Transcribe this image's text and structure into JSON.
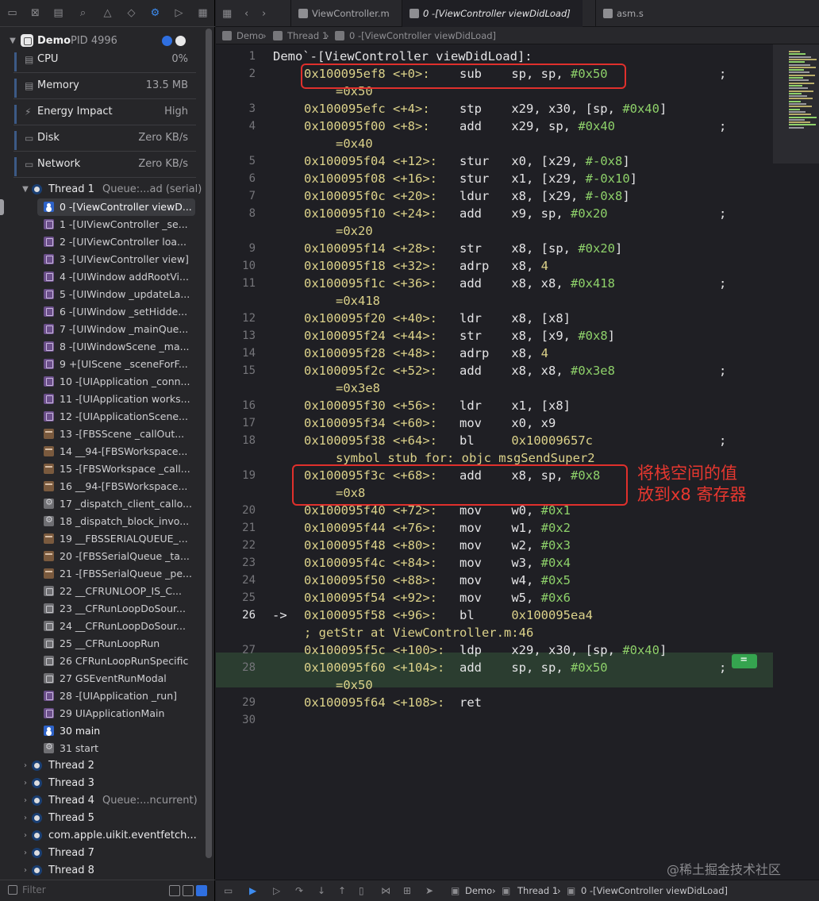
{
  "navigator": {
    "process": {
      "name": "Demo",
      "pid": "PID 4996"
    },
    "gauges": [
      {
        "label": "CPU",
        "value": "0%",
        "icon": "cpu-icon"
      },
      {
        "label": "Memory",
        "value": "13.5 MB",
        "icon": "memory-icon"
      },
      {
        "label": "Energy Impact",
        "value": "High",
        "icon": "energy-icon"
      },
      {
        "label": "Disk",
        "value": "Zero KB/s",
        "icon": "disk-icon"
      },
      {
        "label": "Network",
        "value": "Zero KB/s",
        "icon": "network-icon"
      }
    ],
    "thread1": {
      "name": "Thread 1",
      "queue": "Queue:...ad (serial)"
    },
    "frames": [
      {
        "label": "0 -[ViewController viewD...",
        "kind": "user"
      },
      {
        "label": "1 -[UIViewController _se...",
        "kind": "purple"
      },
      {
        "label": "2 -[UIViewController loa...",
        "kind": "purple"
      },
      {
        "label": "3 -[UIViewController view]",
        "kind": "purple"
      },
      {
        "label": "4 -[UIWindow addRootVi...",
        "kind": "purple"
      },
      {
        "label": "5 -[UIWindow _updateLa...",
        "kind": "purple"
      },
      {
        "label": "6 -[UIWindow _setHidde...",
        "kind": "purple"
      },
      {
        "label": "7 -[UIWindow _mainQue...",
        "kind": "purple"
      },
      {
        "label": "8 -[UIWindowScene _ma...",
        "kind": "purple"
      },
      {
        "label": "9 +[UIScene _sceneForF...",
        "kind": "purple"
      },
      {
        "label": "10 -[UIApplication _conn...",
        "kind": "purple"
      },
      {
        "label": "11 -[UIApplication works...",
        "kind": "purple"
      },
      {
        "label": "12 -[UIApplicationScene...",
        "kind": "purple"
      },
      {
        "label": "13 -[FBSScene _callOut...",
        "kind": "brown"
      },
      {
        "label": "14 __94-[FBSWorkspace...",
        "kind": "brown"
      },
      {
        "label": "15 -[FBSWorkspace _call...",
        "kind": "brown"
      },
      {
        "label": "16 __94-[FBSWorkspace...",
        "kind": "brown"
      },
      {
        "label": "17 _dispatch_client_callo...",
        "kind": "gear"
      },
      {
        "label": "18 _dispatch_block_invo...",
        "kind": "gear"
      },
      {
        "label": "19 __FBSSERIALQUEUE_...",
        "kind": "brown"
      },
      {
        "label": "20 -[FBSSerialQueue _ta...",
        "kind": "brown"
      },
      {
        "label": "21 -[FBSSerialQueue _pe...",
        "kind": "brown"
      },
      {
        "label": "22 __CFRUNLOOP_IS_C...",
        "kind": "gray"
      },
      {
        "label": "23 __CFRunLoopDoSour...",
        "kind": "gray"
      },
      {
        "label": "24 __CFRunLoopDoSour...",
        "kind": "gray"
      },
      {
        "label": "25 __CFRunLoopRun",
        "kind": "gray"
      },
      {
        "label": "26 CFRunLoopRunSpecific",
        "kind": "gray"
      },
      {
        "label": "27 GSEventRunModal",
        "kind": "gray"
      },
      {
        "label": "28 -[UIApplication _run]",
        "kind": "purple"
      },
      {
        "label": "29 UIApplicationMain",
        "kind": "purple"
      },
      {
        "label": "30 main",
        "kind": "user"
      },
      {
        "label": "31 start",
        "kind": "gear"
      }
    ],
    "other_threads": [
      {
        "name": "Thread 2",
        "queue": ""
      },
      {
        "name": "Thread 3",
        "queue": ""
      },
      {
        "name": "Thread 4",
        "queue": "Queue:...ncurrent)"
      },
      {
        "name": "Thread 5",
        "queue": ""
      },
      {
        "name": "com.apple.uikit.eventfetch...",
        "queue": ""
      },
      {
        "name": "Thread 7",
        "queue": ""
      },
      {
        "name": "Thread 8",
        "queue": ""
      }
    ],
    "filter_placeholder": "Filter"
  },
  "tabs": [
    {
      "label": "ViewController.m",
      "active": false
    },
    {
      "label": "0 -[ViewController viewDidLoad]",
      "active": true
    },
    {
      "label": "asm.s",
      "active": false
    }
  ],
  "jumpbar": {
    "app": "Demo",
    "thread": "Thread 1",
    "frame": "0 -[ViewController viewDidLoad]"
  },
  "code": {
    "header": "Demo`-[ViewController viewDidLoad]:",
    "current_line": 26,
    "lines": [
      {
        "n": "1"
      },
      {
        "n": "2",
        "addr": "0x100095ef8",
        "off": "<+0>:",
        "op": "sub",
        "args": "sp, sp, ",
        "imm": "#0x50",
        "semi": true,
        "cont": "=0x50"
      },
      {
        "n": "3",
        "addr": "0x100095efc",
        "off": "<+4>:",
        "op": "stp",
        "args": "x29, x30, [sp, ",
        "imm": "#0x40",
        "tail": "]"
      },
      {
        "n": "4",
        "addr": "0x100095f00",
        "off": "<+8>:",
        "op": "add",
        "args": "x29, sp, ",
        "imm": "#0x40",
        "semi": true,
        "cont": "=0x40"
      },
      {
        "n": "5",
        "addr": "0x100095f04",
        "off": "<+12>:",
        "op": "stur",
        "args": "x0, [x29, ",
        "imm": "#-0x8",
        "tail": "]"
      },
      {
        "n": "6",
        "addr": "0x100095f08",
        "off": "<+16>:",
        "op": "stur",
        "args": "x1, [x29, ",
        "imm": "#-0x10",
        "tail": "]"
      },
      {
        "n": "7",
        "addr": "0x100095f0c",
        "off": "<+20>:",
        "op": "ldur",
        "args": "x8, [x29, ",
        "imm": "#-0x8",
        "tail": "]"
      },
      {
        "n": "8",
        "addr": "0x100095f10",
        "off": "<+24>:",
        "op": "add",
        "args": "x9, sp, ",
        "imm": "#0x20",
        "semi": true,
        "cont": "=0x20"
      },
      {
        "n": "9",
        "addr": "0x100095f14",
        "off": "<+28>:",
        "op": "str",
        "args": "x8, [sp, ",
        "imm": "#0x20",
        "tail": "]"
      },
      {
        "n": "10",
        "addr": "0x100095f18",
        "off": "<+32>:",
        "op": "adrp",
        "args": "x8, ",
        "num": "4"
      },
      {
        "n": "11",
        "addr": "0x100095f1c",
        "off": "<+36>:",
        "op": "add",
        "args": "x8, x8, ",
        "imm": "#0x418",
        "semi": true,
        "cont": "=0x418"
      },
      {
        "n": "12",
        "addr": "0x100095f20",
        "off": "<+40>:",
        "op": "ldr",
        "args": "x8, [x8]"
      },
      {
        "n": "13",
        "addr": "0x100095f24",
        "off": "<+44>:",
        "op": "str",
        "args": "x8, [x9, ",
        "imm": "#0x8",
        "tail": "]"
      },
      {
        "n": "14",
        "addr": "0x100095f28",
        "off": "<+48>:",
        "op": "adrp",
        "args": "x8, ",
        "num": "4"
      },
      {
        "n": "15",
        "addr": "0x100095f2c",
        "off": "<+52>:",
        "op": "add",
        "args": "x8, x8, ",
        "imm": "#0x3e8",
        "semi": true,
        "cont": "=0x3e8"
      },
      {
        "n": "16",
        "addr": "0x100095f30",
        "off": "<+56>:",
        "op": "ldr",
        "args": "x1, [x8]"
      },
      {
        "n": "17",
        "addr": "0x100095f34",
        "off": "<+60>:",
        "op": "mov",
        "args": "x0, x9"
      },
      {
        "n": "18",
        "addr": "0x100095f38",
        "off": "<+64>:",
        "op": "bl",
        "args": "",
        "target": "0x10009657c",
        "semi": true,
        "cont": "symbol stub for: objc_msgSendSuper2"
      },
      {
        "n": "19",
        "addr": "0x100095f3c",
        "off": "<+68>:",
        "op": "add",
        "args": "x8, sp, ",
        "imm": "#0x8",
        "cont": "=0x8"
      },
      {
        "n": "20",
        "addr": "0x100095f40",
        "off": "<+72>:",
        "op": "mov",
        "args": "w0, ",
        "imm": "#0x1"
      },
      {
        "n": "21",
        "addr": "0x100095f44",
        "off": "<+76>:",
        "op": "mov",
        "args": "w1, ",
        "imm": "#0x2"
      },
      {
        "n": "22",
        "addr": "0x100095f48",
        "off": "<+80>:",
        "op": "mov",
        "args": "w2, ",
        "imm": "#0x3"
      },
      {
        "n": "23",
        "addr": "0x100095f4c",
        "off": "<+84>:",
        "op": "mov",
        "args": "w3, ",
        "imm": "#0x4"
      },
      {
        "n": "24",
        "addr": "0x100095f50",
        "off": "<+88>:",
        "op": "mov",
        "args": "w4, ",
        "imm": "#0x5"
      },
      {
        "n": "25",
        "addr": "0x100095f54",
        "off": "<+92>:",
        "op": "mov",
        "args": "w5, ",
        "imm": "#0x6"
      },
      {
        "n": "26",
        "arrow": "->",
        "addr": "0x100095f58",
        "off": "<+96>:",
        "op": "bl",
        "args": "",
        "target": "0x100095ea4",
        "cont": "; getStr at ViewController.m:46"
      },
      {
        "n": "27",
        "addr": "0x100095f5c",
        "off": "<+100>:",
        "op": "ldp",
        "args": "x29, x30, [sp, ",
        "imm": "#0x40",
        "tail": "]"
      },
      {
        "n": "28",
        "addr": "0x100095f60",
        "off": "<+104>:",
        "op": "add",
        "args": "sp, sp, ",
        "imm": "#0x50",
        "semi": true,
        "cont": "=0x50"
      },
      {
        "n": "29",
        "addr": "0x100095f64",
        "off": "<+108>:",
        "op": "ret",
        "args": ""
      },
      {
        "n": "30"
      }
    ]
  },
  "annotation": [
    "将栈空间的值",
    "放到x8 寄存器"
  ],
  "bottom_bar": {
    "app": "Demo",
    "thread": "Thread 1",
    "frame": "0 -[ViewController viewDidLoad]"
  },
  "watermark": "@稀土掘金技术社区",
  "colors": {
    "address": "#dcd28a",
    "immediate": "#8ed16a",
    "annotation": "#e0302c",
    "current_line_bg": "#2b3d30"
  }
}
